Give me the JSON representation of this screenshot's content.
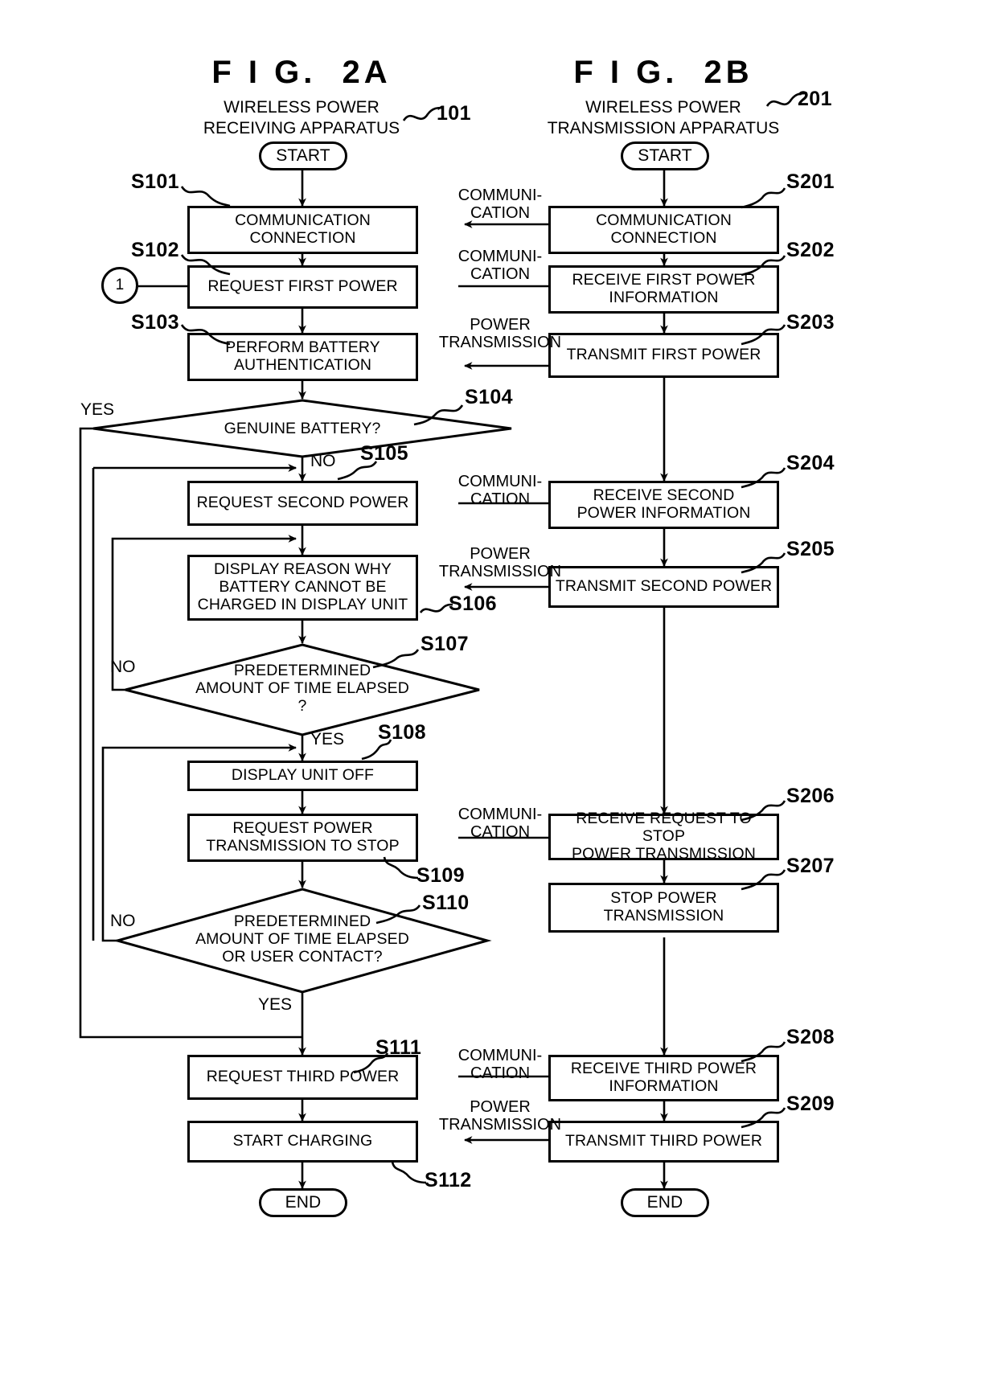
{
  "figures": {
    "left": {
      "title": "F I G.  2A",
      "subtitle_line1": "WIRELESS POWER",
      "subtitle_line2": "RECEIVING APPARATUS",
      "ref": "101",
      "start": "START",
      "end": "END",
      "connector": "1"
    },
    "right": {
      "title": "F I G.  2B",
      "subtitle_line1": "WIRELESS POWER",
      "subtitle_line2": "TRANSMISSION APPARATUS",
      "ref": "201",
      "start": "START",
      "end": "END"
    }
  },
  "left_steps": {
    "s101": {
      "id": "S101",
      "text": "COMMUNICATION\nCONNECTION"
    },
    "s102": {
      "id": "S102",
      "text": "REQUEST FIRST POWER"
    },
    "s103": {
      "id": "S103",
      "text": "PERFORM BATTERY\nAUTHENTICATION"
    },
    "s104": {
      "id": "S104",
      "text": "GENUINE BATTERY?",
      "yes": "YES",
      "no": "NO"
    },
    "s105": {
      "id": "S105",
      "text": "REQUEST SECOND POWER"
    },
    "s106": {
      "id": "S106",
      "text": "DISPLAY REASON WHY\nBATTERY CANNOT BE\nCHARGED IN DISPLAY UNIT"
    },
    "s107": {
      "id": "S107",
      "text": "PREDETERMINED\nAMOUNT OF TIME ELAPSED\n?",
      "yes": "YES",
      "no": "NO"
    },
    "s108": {
      "id": "S108",
      "text": "DISPLAY UNIT OFF"
    },
    "s109": {
      "id": "S109",
      "text": "REQUEST POWER\nTRANSMISSION TO STOP"
    },
    "s110": {
      "id": "S110",
      "text": "PREDETERMINED\nAMOUNT OF TIME ELAPSED\nOR USER CONTACT?",
      "yes": "YES",
      "no": "NO"
    },
    "s111": {
      "id": "S111",
      "text": "REQUEST THIRD POWER"
    },
    "s112": {
      "id": "S112",
      "text": "START CHARGING"
    }
  },
  "right_steps": {
    "s201": {
      "id": "S201",
      "text": "COMMUNICATION\nCONNECTION"
    },
    "s202": {
      "id": "S202",
      "text": "RECEIVE FIRST POWER\nINFORMATION"
    },
    "s203": {
      "id": "S203",
      "text": "TRANSMIT FIRST POWER"
    },
    "s204": {
      "id": "S204",
      "text": "RECEIVE SECOND\nPOWER INFORMATION"
    },
    "s205": {
      "id": "S205",
      "text": "TRANSMIT SECOND POWER"
    },
    "s206": {
      "id": "S206",
      "text": "RECEIVE REQUEST TO STOP\nPOWER TRANSMISSION"
    },
    "s207": {
      "id": "S207",
      "text": "STOP POWER\nTRANSMISSION"
    },
    "s208": {
      "id": "S208",
      "text": "RECEIVE THIRD POWER\nINFORMATION"
    },
    "s209": {
      "id": "S209",
      "text": "TRANSMIT THIRD POWER"
    }
  },
  "edge_labels": {
    "comm1": "COMMUNI-\nCATION",
    "comm2": "COMMUNI-\nCATION",
    "power1": "POWER\nTRANSMISSION",
    "comm3": "COMMUNI-\nCATION",
    "power2": "POWER\nTRANSMISSION",
    "comm4": "COMMUNI-\nCATION",
    "comm5": "COMMUNI-\nCATION",
    "power3": "POWER\nTRANSMISSION"
  },
  "colors": {
    "ink": "#000000",
    "paper": "#ffffff"
  }
}
